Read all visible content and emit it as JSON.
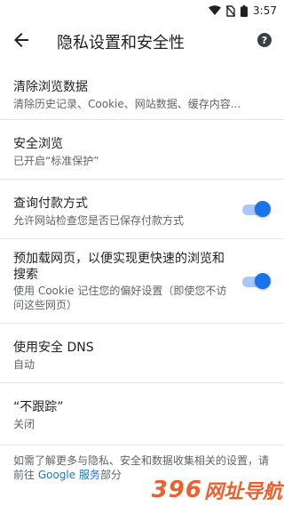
{
  "status": {
    "time": "3:57"
  },
  "app_bar": {
    "title": "隐私设置和安全性",
    "back_icon": "arrow-back-icon",
    "help_icon": "help-icon"
  },
  "settings": [
    {
      "title": "清除浏览数据",
      "subtitle": "清除历史记录、Cookie、网站数据、缓存内容..."
    },
    {
      "title": "安全浏览",
      "subtitle": "已开启“标准保护”"
    },
    {
      "title": "查询付款方式",
      "subtitle": "允许网站检查您是否已保存付款方式",
      "toggle": true
    },
    {
      "title": "预加载网页，以便实现更快速的浏览和搜索",
      "subtitle": "使用 Cookie 记住您的偏好设置（即使您不访问这些网页）",
      "toggle": true
    },
    {
      "title": "使用安全 DNS",
      "subtitle": "自动"
    },
    {
      "title": "“不跟踪”",
      "subtitle": "关闭"
    }
  ],
  "footer": {
    "text_before": "如需了解更多与隐私、安全和数据收集相关的设置，请前往 ",
    "link": "Google 服务",
    "text_after": "部分"
  },
  "watermark": {
    "number": "396",
    "text": "网址导航"
  },
  "colors": {
    "accent": "#1a73e8",
    "watermark": "#e8501a"
  }
}
